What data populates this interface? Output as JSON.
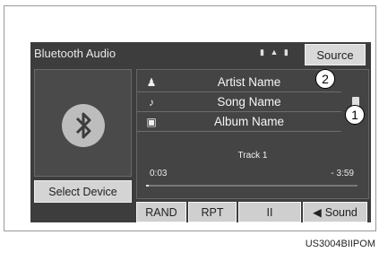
{
  "header": {
    "title": "Bluetooth Audio",
    "source_label": "Source"
  },
  "left_panel": {
    "select_device_label": "Select Device"
  },
  "track": {
    "artist": "Artist Name",
    "song": "Song Name",
    "album": "Album Name",
    "track_number": "Track 1",
    "elapsed": "0:03",
    "remaining": "- 3:59",
    "progress_fraction": 0.013
  },
  "controls": {
    "rand": "RAND",
    "rpt": "RPT",
    "pause": "II",
    "sound": "Sound"
  },
  "callouts": {
    "one": "1",
    "two": "2"
  },
  "caption": "US3004BIIPOM"
}
